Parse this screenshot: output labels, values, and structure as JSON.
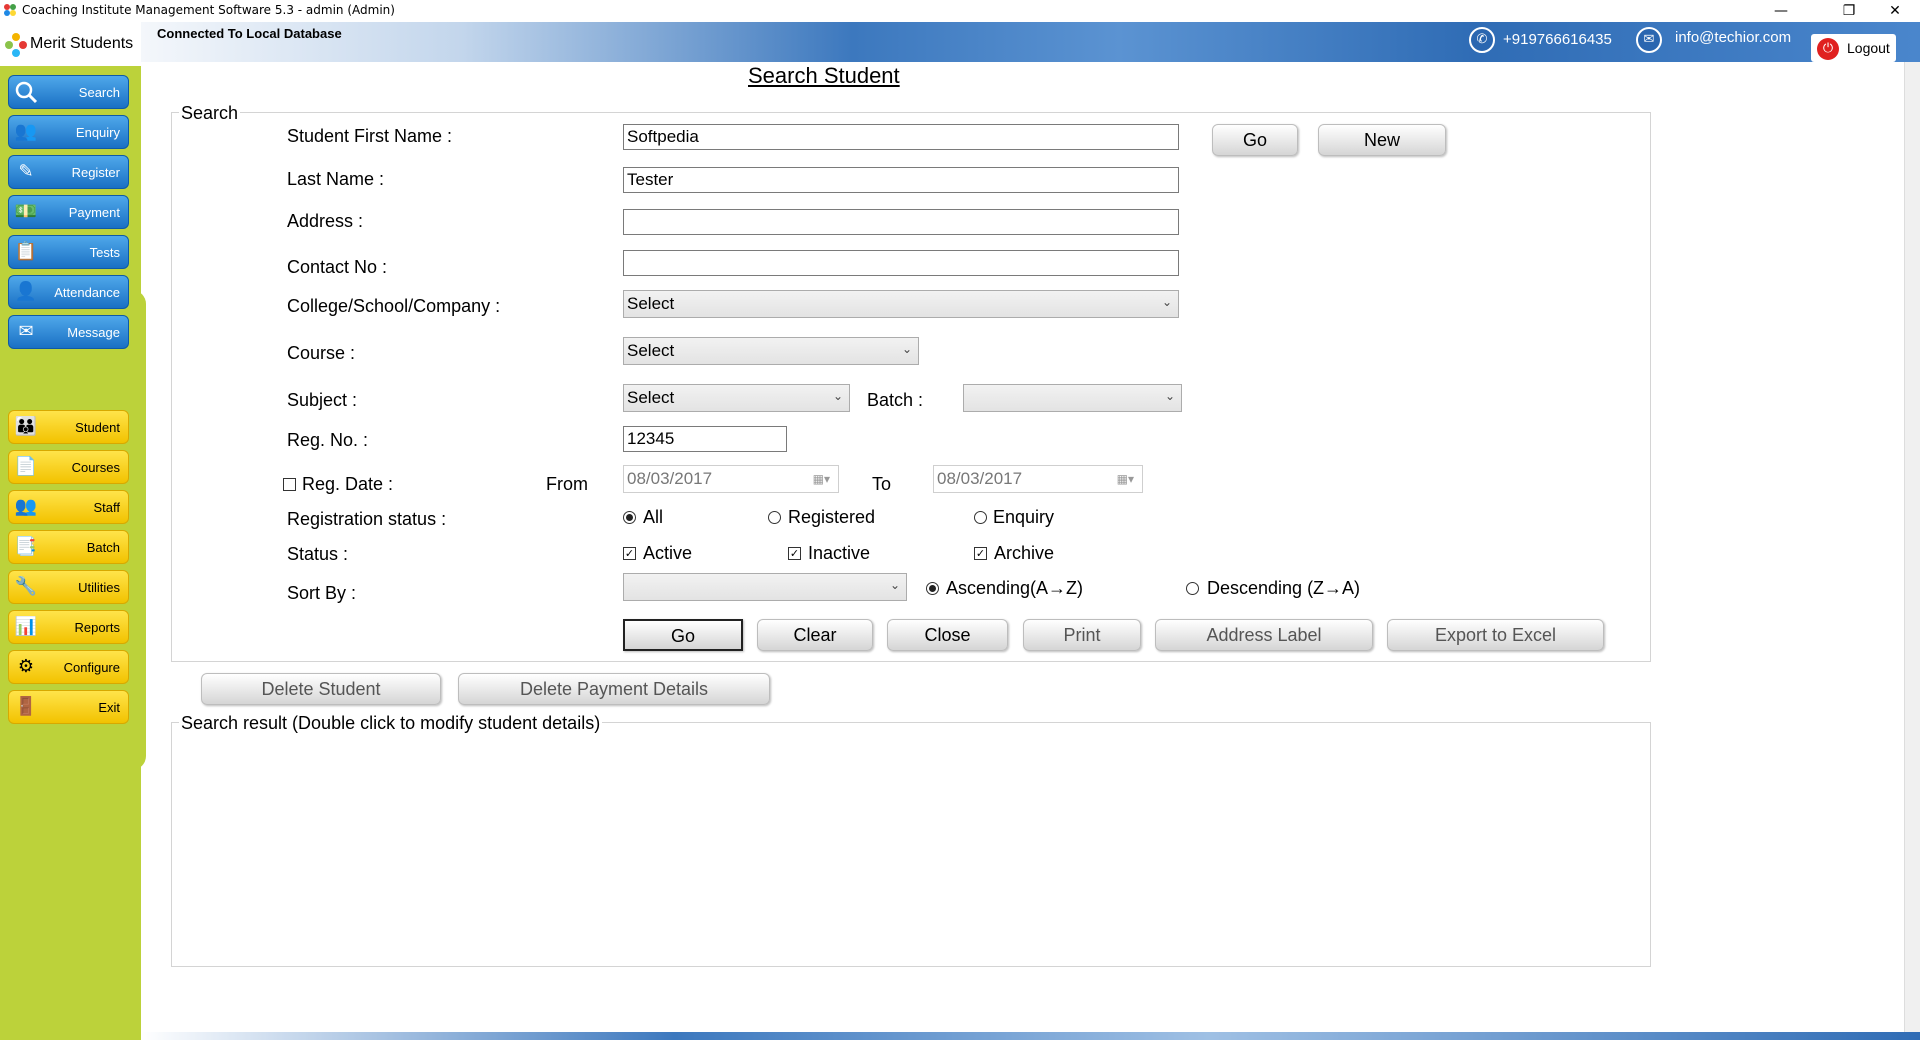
{
  "window": {
    "title": "Coaching Institute Management Software 5.3  -  admin (Admin)",
    "minimize_icon": "minimize-icon",
    "restore_icon": "restore-icon",
    "close_icon": "close-icon"
  },
  "header": {
    "connection_status": "Connected To  Local Database",
    "phone": "+919766616435",
    "email": "info@techior.com",
    "logout_label": "Logout"
  },
  "brand": {
    "name": "Merit Students"
  },
  "nav_primary": [
    {
      "label": "Search",
      "icon": "magnifier-icon"
    },
    {
      "label": "Enquiry",
      "icon": "people-icon"
    },
    {
      "label": "Register",
      "icon": "pen-icon"
    },
    {
      "label": "Payment",
      "icon": "money-icon"
    },
    {
      "label": "Tests",
      "icon": "test-paper-icon"
    },
    {
      "label": "Attendance",
      "icon": "attendance-icon"
    },
    {
      "label": "Message",
      "icon": "envelope-icon"
    }
  ],
  "nav_secondary": [
    {
      "label": "Student",
      "icon": "students-icon"
    },
    {
      "label": "Courses",
      "icon": "document-icon"
    },
    {
      "label": "Staff",
      "icon": "staff-icon"
    },
    {
      "label": "Batch",
      "icon": "batch-icon"
    },
    {
      "label": "Utilities",
      "icon": "toolbox-icon"
    },
    {
      "label": "Reports",
      "icon": "reports-icon"
    },
    {
      "label": "Configure",
      "icon": "gear-icon"
    },
    {
      "label": "Exit",
      "icon": "exit-door-icon"
    }
  ],
  "main": {
    "title": "Search Student",
    "search_group_label": "Search",
    "fields": {
      "first_name_label": "Student First Name :",
      "first_name_value": "Softpedia",
      "last_name_label": "Last Name :",
      "last_name_value": "Tester",
      "address_label": "Address :",
      "address_value": "",
      "contact_label": "Contact No :",
      "contact_value": "",
      "college_label": "College/School/Company :",
      "college_value": "Select",
      "course_label": "Course :",
      "course_value": "Select",
      "subject_label": "Subject :",
      "subject_value": "Select",
      "batch_label": "Batch :",
      "batch_value": "",
      "regno_label": "Reg. No. :",
      "regno_value": "12345",
      "regdate_label": "Reg. Date :",
      "from_label": "From",
      "from_value": "08/03/2017",
      "to_label": "To",
      "to_value": "08/03/2017",
      "reg_status_label": "Registration status :",
      "reg_status_options": [
        "All",
        "Registered",
        "Enquiry"
      ],
      "status_label": "Status :",
      "status_options": [
        "Active",
        "Inactive",
        "Archive"
      ],
      "sortby_label": "Sort By :",
      "sortby_value": "",
      "sort_options": [
        "Ascending(A→Z)",
        "Descending (Z→A)"
      ]
    },
    "top_buttons": {
      "go": "Go",
      "new": "New"
    },
    "action_buttons": [
      "Go",
      "Clear",
      "Close",
      "Print",
      "Address Label",
      "Export to Excel"
    ],
    "delete_buttons": [
      "Delete Student",
      "Delete Payment Details"
    ],
    "results_group_label": "Search result (Double click to modify student details)"
  },
  "colors": {
    "sidebar": "#bcd23a",
    "nav_blue": "#1a70c4",
    "nav_yellow": "#f2c200",
    "header_blue": "#3c78be",
    "logout_red": "#e0201f"
  }
}
